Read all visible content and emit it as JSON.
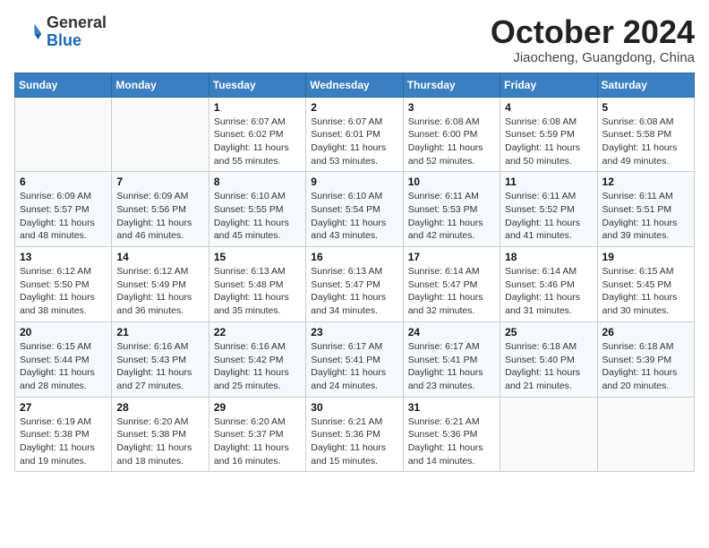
{
  "logo": {
    "general": "General",
    "blue": "Blue"
  },
  "header": {
    "month": "October 2024",
    "location": "Jiaocheng, Guangdong, China"
  },
  "weekdays": [
    "Sunday",
    "Monday",
    "Tuesday",
    "Wednesday",
    "Thursday",
    "Friday",
    "Saturday"
  ],
  "weeks": [
    [
      {
        "day": "",
        "info": ""
      },
      {
        "day": "",
        "info": ""
      },
      {
        "day": "1",
        "info": "Sunrise: 6:07 AM\nSunset: 6:02 PM\nDaylight: 11 hours and 55 minutes."
      },
      {
        "day": "2",
        "info": "Sunrise: 6:07 AM\nSunset: 6:01 PM\nDaylight: 11 hours and 53 minutes."
      },
      {
        "day": "3",
        "info": "Sunrise: 6:08 AM\nSunset: 6:00 PM\nDaylight: 11 hours and 52 minutes."
      },
      {
        "day": "4",
        "info": "Sunrise: 6:08 AM\nSunset: 5:59 PM\nDaylight: 11 hours and 50 minutes."
      },
      {
        "day": "5",
        "info": "Sunrise: 6:08 AM\nSunset: 5:58 PM\nDaylight: 11 hours and 49 minutes."
      }
    ],
    [
      {
        "day": "6",
        "info": "Sunrise: 6:09 AM\nSunset: 5:57 PM\nDaylight: 11 hours and 48 minutes."
      },
      {
        "day": "7",
        "info": "Sunrise: 6:09 AM\nSunset: 5:56 PM\nDaylight: 11 hours and 46 minutes."
      },
      {
        "day": "8",
        "info": "Sunrise: 6:10 AM\nSunset: 5:55 PM\nDaylight: 11 hours and 45 minutes."
      },
      {
        "day": "9",
        "info": "Sunrise: 6:10 AM\nSunset: 5:54 PM\nDaylight: 11 hours and 43 minutes."
      },
      {
        "day": "10",
        "info": "Sunrise: 6:11 AM\nSunset: 5:53 PM\nDaylight: 11 hours and 42 minutes."
      },
      {
        "day": "11",
        "info": "Sunrise: 6:11 AM\nSunset: 5:52 PM\nDaylight: 11 hours and 41 minutes."
      },
      {
        "day": "12",
        "info": "Sunrise: 6:11 AM\nSunset: 5:51 PM\nDaylight: 11 hours and 39 minutes."
      }
    ],
    [
      {
        "day": "13",
        "info": "Sunrise: 6:12 AM\nSunset: 5:50 PM\nDaylight: 11 hours and 38 minutes."
      },
      {
        "day": "14",
        "info": "Sunrise: 6:12 AM\nSunset: 5:49 PM\nDaylight: 11 hours and 36 minutes."
      },
      {
        "day": "15",
        "info": "Sunrise: 6:13 AM\nSunset: 5:48 PM\nDaylight: 11 hours and 35 minutes."
      },
      {
        "day": "16",
        "info": "Sunrise: 6:13 AM\nSunset: 5:47 PM\nDaylight: 11 hours and 34 minutes."
      },
      {
        "day": "17",
        "info": "Sunrise: 6:14 AM\nSunset: 5:47 PM\nDaylight: 11 hours and 32 minutes."
      },
      {
        "day": "18",
        "info": "Sunrise: 6:14 AM\nSunset: 5:46 PM\nDaylight: 11 hours and 31 minutes."
      },
      {
        "day": "19",
        "info": "Sunrise: 6:15 AM\nSunset: 5:45 PM\nDaylight: 11 hours and 30 minutes."
      }
    ],
    [
      {
        "day": "20",
        "info": "Sunrise: 6:15 AM\nSunset: 5:44 PM\nDaylight: 11 hours and 28 minutes."
      },
      {
        "day": "21",
        "info": "Sunrise: 6:16 AM\nSunset: 5:43 PM\nDaylight: 11 hours and 27 minutes."
      },
      {
        "day": "22",
        "info": "Sunrise: 6:16 AM\nSunset: 5:42 PM\nDaylight: 11 hours and 25 minutes."
      },
      {
        "day": "23",
        "info": "Sunrise: 6:17 AM\nSunset: 5:41 PM\nDaylight: 11 hours and 24 minutes."
      },
      {
        "day": "24",
        "info": "Sunrise: 6:17 AM\nSunset: 5:41 PM\nDaylight: 11 hours and 23 minutes."
      },
      {
        "day": "25",
        "info": "Sunrise: 6:18 AM\nSunset: 5:40 PM\nDaylight: 11 hours and 21 minutes."
      },
      {
        "day": "26",
        "info": "Sunrise: 6:18 AM\nSunset: 5:39 PM\nDaylight: 11 hours and 20 minutes."
      }
    ],
    [
      {
        "day": "27",
        "info": "Sunrise: 6:19 AM\nSunset: 5:38 PM\nDaylight: 11 hours and 19 minutes."
      },
      {
        "day": "28",
        "info": "Sunrise: 6:20 AM\nSunset: 5:38 PM\nDaylight: 11 hours and 18 minutes."
      },
      {
        "day": "29",
        "info": "Sunrise: 6:20 AM\nSunset: 5:37 PM\nDaylight: 11 hours and 16 minutes."
      },
      {
        "day": "30",
        "info": "Sunrise: 6:21 AM\nSunset: 5:36 PM\nDaylight: 11 hours and 15 minutes."
      },
      {
        "day": "31",
        "info": "Sunrise: 6:21 AM\nSunset: 5:36 PM\nDaylight: 11 hours and 14 minutes."
      },
      {
        "day": "",
        "info": ""
      },
      {
        "day": "",
        "info": ""
      }
    ]
  ]
}
